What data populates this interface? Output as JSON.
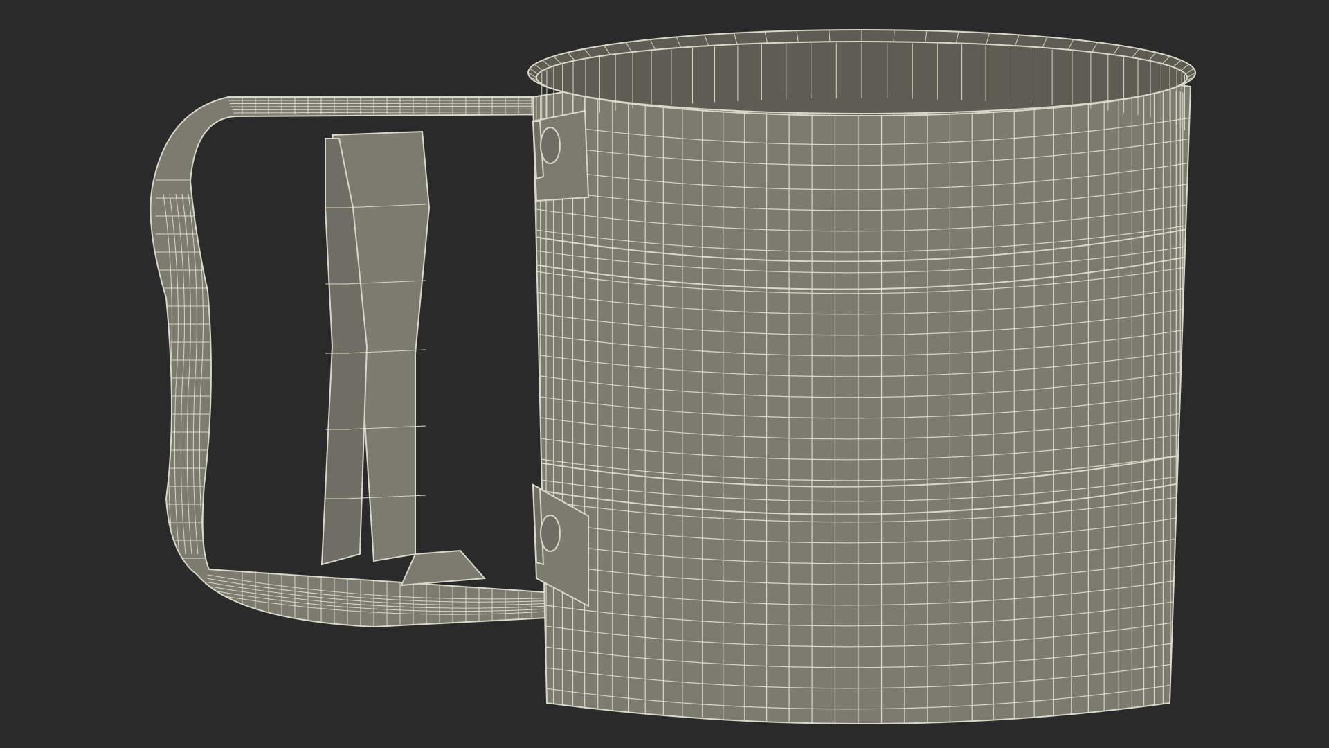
{
  "scene": {
    "subject": "flour-sifter-wireframe-render",
    "background_color": "#2a2a2a",
    "mesh_fill_color": "#7c7b70",
    "mesh_fill_dark_color": "#6f6e64",
    "wire_color": "#d8d8c8",
    "interior_color": "#5e5d54",
    "cylinder": {
      "vertical_segments": 44,
      "ring_bands": 2
    }
  }
}
